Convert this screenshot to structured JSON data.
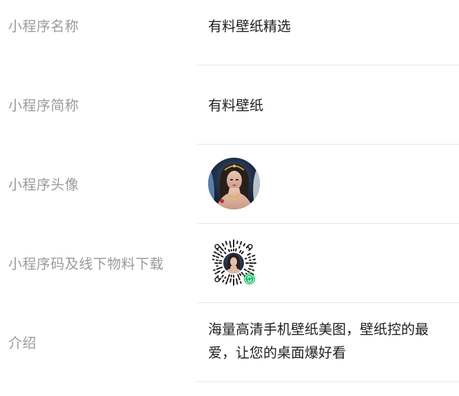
{
  "info": {
    "name": {
      "label": "小程序名称",
      "value": "有料壁纸精选"
    },
    "short_name": {
      "label": "小程序简称",
      "value": "有料壁纸"
    },
    "avatar": {
      "label": "小程序头像"
    },
    "qrcode": {
      "label": "小程序码及线下物料下载"
    },
    "intro": {
      "label": "介绍",
      "value": "海量高清手机壁纸美图，壁纸控的最爱，让您的桌面爆好看"
    }
  }
}
